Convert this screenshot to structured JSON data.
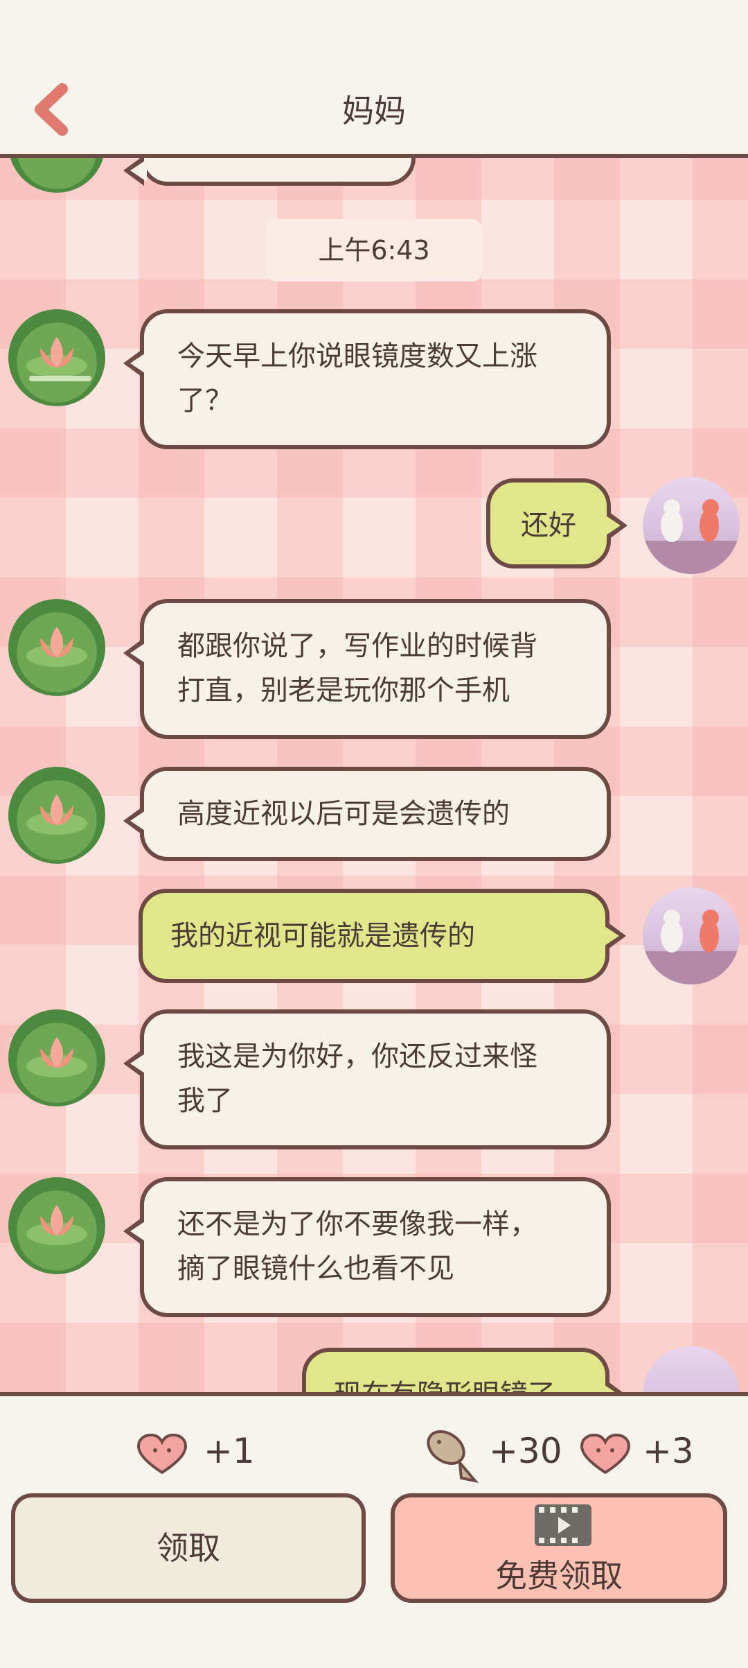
{
  "header": {
    "title": "妈妈",
    "back_icon": "chevron-left-icon",
    "accent": "#e07a6e"
  },
  "chat": {
    "timestamp": "上午6:43",
    "messages": [
      {
        "from": "mom",
        "text_lines": [
          "今天早上你说眼镜度数又上涨",
          "了？"
        ]
      },
      {
        "from": "me",
        "text_lines": [
          "还好"
        ]
      },
      {
        "from": "mom",
        "text_lines": [
          "都跟你说了，写作业的时候背",
          "打直，别老是玩你那个手机"
        ]
      },
      {
        "from": "mom",
        "text_lines": [
          "高度近视以后可是会遗传的"
        ]
      },
      {
        "from": "me",
        "text_lines": [
          "我的近视可能就是遗传的"
        ]
      },
      {
        "from": "mom",
        "text_lines": [
          "我这是为你好，你还反过来怪",
          "我了"
        ]
      },
      {
        "from": "mom",
        "text_lines": [
          "还不是为了你不要像我一样，",
          "摘了眼镜什么也看不见"
        ]
      },
      {
        "from": "me",
        "text_lines": [
          "现在有隐形眼镜了"
        ]
      }
    ]
  },
  "rewards": {
    "claim": {
      "hearts": "+1"
    },
    "free": {
      "fish": "+30",
      "hearts": "+3"
    }
  },
  "buttons": {
    "claim_label": "领取",
    "free_claim_label": "免费领取",
    "video_icon": "video-play-icon"
  },
  "colors": {
    "bubble_mom": "#f6f2ea",
    "bubble_me": "#dfe78a",
    "outline": "#6e4a45",
    "claim_button": "#f1ebdc",
    "free_button": "#fcc1b2"
  }
}
